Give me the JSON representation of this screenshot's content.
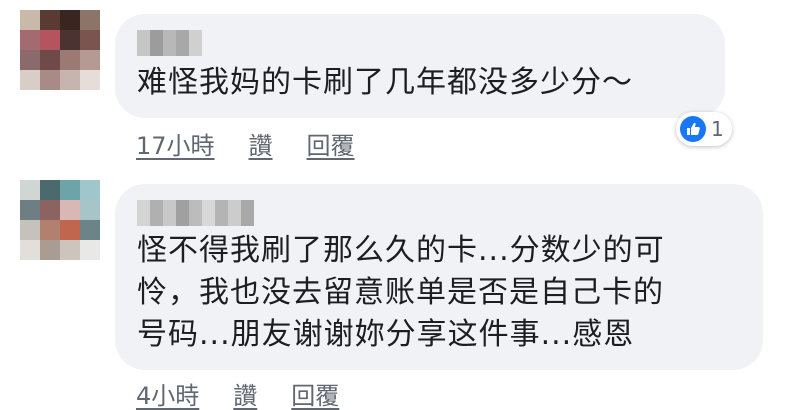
{
  "comments": [
    {
      "text": "难怪我妈的卡刷了几年都没多少分～",
      "time": "17小時",
      "like_label": "讚",
      "reply_label": "回覆",
      "reaction_count": "1",
      "reaction_icon": "like-icon"
    },
    {
      "text_lines": [
        "怪不得我刷了那么久的卡...分数少的可",
        "怜，我也没去留意账单是否是自己卡的",
        "号码...朋友谢谢妳分享这件事...感恩"
      ],
      "time": "4小時",
      "like_label": "讚",
      "reply_label": "回覆"
    }
  ],
  "colors": {
    "bubble": "#f0f2f5",
    "text": "#1c1e21",
    "secondary": "#606770",
    "like_blue": "#1877f2"
  }
}
